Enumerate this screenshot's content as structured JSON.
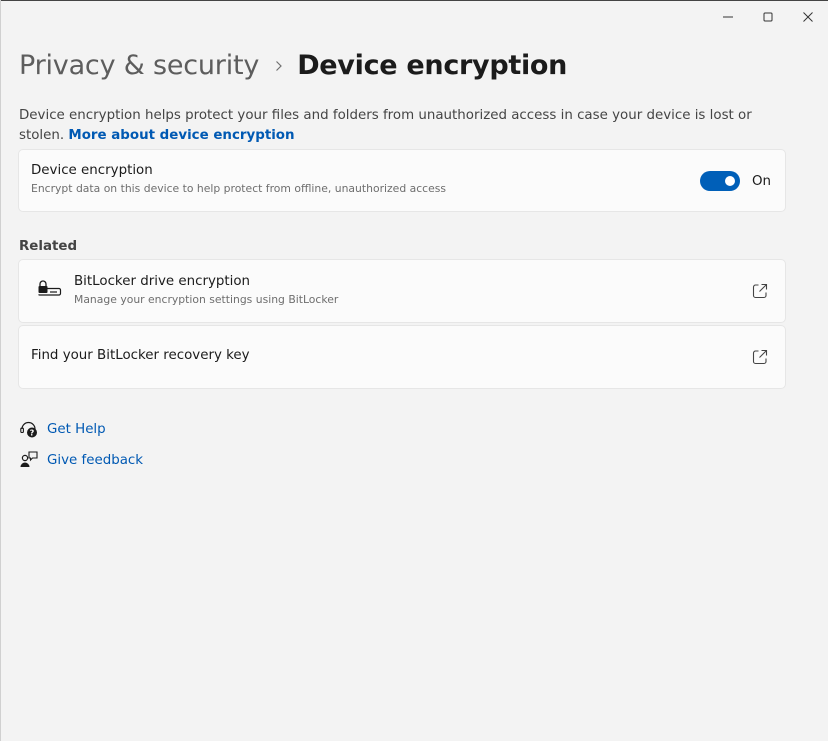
{
  "window": {
    "caption_buttons": [
      "minimize-icon",
      "maximize-icon",
      "close-icon"
    ]
  },
  "breadcrumb": {
    "parent": "Privacy & security",
    "separator_icon": "chevron-right-icon",
    "current": "Device encryption"
  },
  "description": {
    "text": "Device encryption helps protect your files and folders from unauthorized access in case your device is lost or stolen. ",
    "link": "More about device encryption"
  },
  "device_encryption_setting": {
    "title": "Device encryption",
    "subtitle": "Encrypt data on this device to help protect from offline, unauthorized access",
    "toggle_state": "On",
    "toggle_on": true,
    "accent_color": "#005fb8"
  },
  "related": {
    "heading": "Related",
    "items": [
      {
        "title": "BitLocker drive encryption",
        "subtitle": "Manage your encryption settings using BitLocker",
        "icon": "bitlocker-drive-icon",
        "action_icon": "open-external-icon"
      },
      {
        "title": "Find your BitLocker recovery key",
        "action_icon": "open-external-icon"
      }
    ]
  },
  "help": {
    "get_help": "Get Help",
    "give_feedback": "Give feedback",
    "link_color": "#0059b3"
  }
}
